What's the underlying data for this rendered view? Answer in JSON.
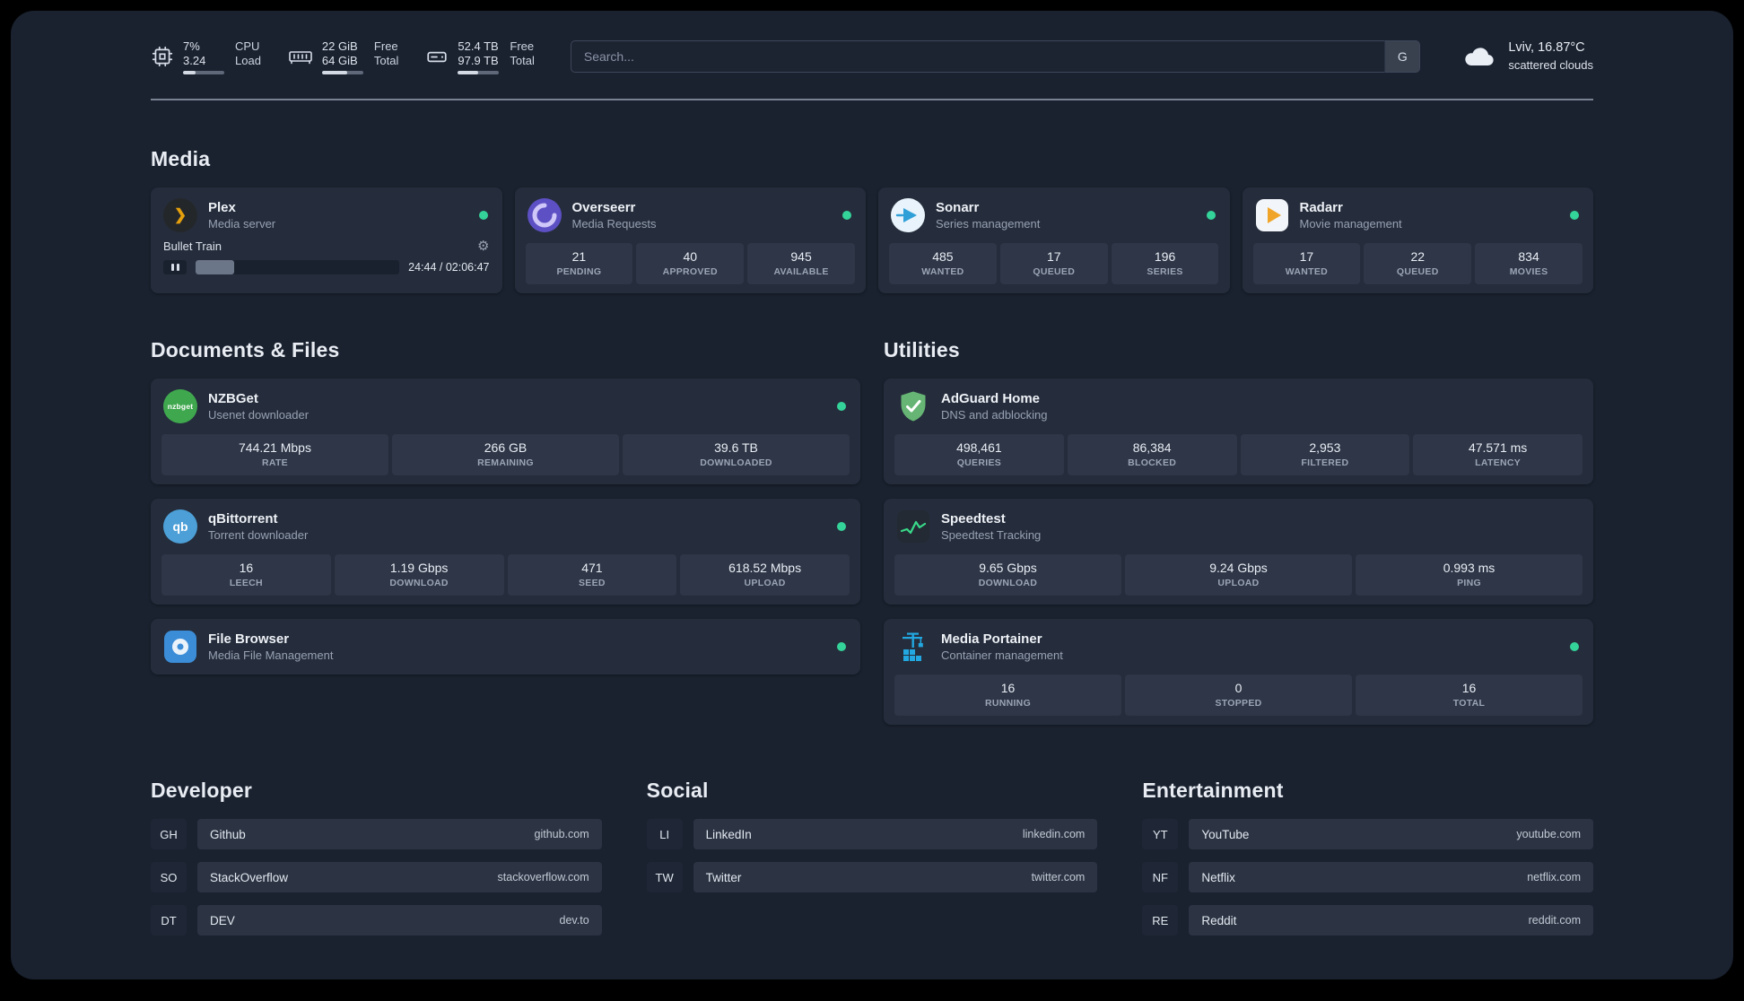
{
  "colors": {
    "background": "#1a2230",
    "card": "#252d3c",
    "stat_tile": "#2e3647",
    "status_online": "#34d399",
    "plex_accent": "#e5a00d",
    "text_primary": "#eef1f6",
    "text_secondary": "#97a1b2"
  },
  "icons": {
    "plex_glyph": "❯",
    "gear_glyph": "⚙",
    "nzbget_text": "nzbget",
    "qb_text": "qb"
  },
  "topbar": {
    "cpu": {
      "value_top": "7%",
      "value_bottom": "3.24",
      "label_top": "CPU",
      "label_bottom": "Load",
      "bar_percent": 30
    },
    "memory": {
      "value_top": "22 GiB",
      "value_bottom": "64 GiB",
      "label_top": "Free",
      "label_bottom": "Total",
      "bar_percent": 60
    },
    "disk": {
      "value_top": "52.4 TB",
      "value_bottom": "97.9 TB",
      "label_top": "Free",
      "label_bottom": "Total",
      "bar_percent": 50
    },
    "search": {
      "placeholder": "Search...",
      "button_label": "G"
    },
    "weather": {
      "location": "Lviv, 16.87°C",
      "condition": "scattered clouds"
    }
  },
  "media": {
    "title": "Media",
    "cards": [
      {
        "name": "Plex",
        "subtitle": "Media server",
        "status": "online",
        "player": {
          "title": "Bullet Train",
          "time": "24:44 / 02:06:47",
          "progress_percent": 19
        }
      },
      {
        "name": "Overseerr",
        "subtitle": "Media Requests",
        "status": "online",
        "stats": [
          {
            "value": "21",
            "label": "PENDING"
          },
          {
            "value": "40",
            "label": "APPROVED"
          },
          {
            "value": "945",
            "label": "AVAILABLE"
          }
        ]
      },
      {
        "name": "Sonarr",
        "subtitle": "Series management",
        "status": "online",
        "stats": [
          {
            "value": "485",
            "label": "WANTED"
          },
          {
            "value": "17",
            "label": "QUEUED"
          },
          {
            "value": "196",
            "label": "SERIES"
          }
        ]
      },
      {
        "name": "Radarr",
        "subtitle": "Movie management",
        "status": "online",
        "stats": [
          {
            "value": "17",
            "label": "WANTED"
          },
          {
            "value": "22",
            "label": "QUEUED"
          },
          {
            "value": "834",
            "label": "MOVIES"
          }
        ]
      }
    ]
  },
  "documents": {
    "title": "Documents & Files",
    "cards": [
      {
        "name": "NZBGet",
        "subtitle": "Usenet downloader",
        "status": "online",
        "stats": [
          {
            "value": "744.21 Mbps",
            "label": "RATE"
          },
          {
            "value": "266 GB",
            "label": "REMAINING"
          },
          {
            "value": "39.6 TB",
            "label": "DOWNLOADED"
          }
        ]
      },
      {
        "name": "qBittorrent",
        "subtitle": "Torrent downloader",
        "status": "online",
        "stats": [
          {
            "value": "16",
            "label": "LEECH"
          },
          {
            "value": "1.19 Gbps",
            "label": "DOWNLOAD"
          },
          {
            "value": "471",
            "label": "SEED"
          },
          {
            "value": "618.52 Mbps",
            "label": "UPLOAD"
          }
        ]
      },
      {
        "name": "File Browser",
        "subtitle": "Media File Management",
        "status": "online"
      }
    ]
  },
  "utilities": {
    "title": "Utilities",
    "cards": [
      {
        "name": "AdGuard Home",
        "subtitle": "DNS and adblocking",
        "stats": [
          {
            "value": "498,461",
            "label": "QUERIES"
          },
          {
            "value": "86,384",
            "label": "BLOCKED"
          },
          {
            "value": "2,953",
            "label": "FILTERED"
          },
          {
            "value": "47.571 ms",
            "label": "LATENCY"
          }
        ]
      },
      {
        "name": "Speedtest",
        "subtitle": "Speedtest Tracking",
        "stats": [
          {
            "value": "9.65 Gbps",
            "label": "DOWNLOAD"
          },
          {
            "value": "9.24 Gbps",
            "label": "UPLOAD"
          },
          {
            "value": "0.993 ms",
            "label": "PING"
          }
        ]
      },
      {
        "name": "Media Portainer",
        "subtitle": "Container management",
        "status": "online",
        "stats": [
          {
            "value": "16",
            "label": "RUNNING"
          },
          {
            "value": "0",
            "label": "STOPPED"
          },
          {
            "value": "16",
            "label": "TOTAL"
          }
        ]
      }
    ]
  },
  "bookmarks": [
    {
      "title": "Developer",
      "items": [
        {
          "abbr": "GH",
          "name": "Github",
          "domain": "github.com"
        },
        {
          "abbr": "SO",
          "name": "StackOverflow",
          "domain": "stackoverflow.com"
        },
        {
          "abbr": "DT",
          "name": "DEV",
          "domain": "dev.to"
        }
      ]
    },
    {
      "title": "Social",
      "items": [
        {
          "abbr": "LI",
          "name": "LinkedIn",
          "domain": "linkedin.com"
        },
        {
          "abbr": "TW",
          "name": "Twitter",
          "domain": "twitter.com"
        }
      ]
    },
    {
      "title": "Entertainment",
      "items": [
        {
          "abbr": "YT",
          "name": "YouTube",
          "domain": "youtube.com"
        },
        {
          "abbr": "NF",
          "name": "Netflix",
          "domain": "netflix.com"
        },
        {
          "abbr": "RE",
          "name": "Reddit",
          "domain": "reddit.com"
        }
      ]
    }
  ]
}
